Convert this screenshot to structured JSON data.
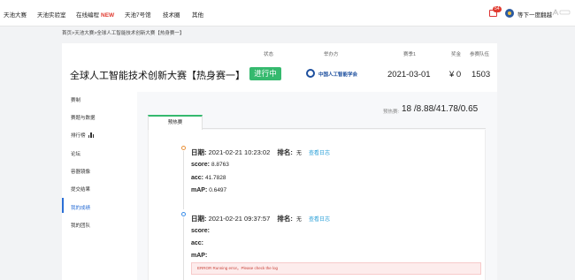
{
  "nav": {
    "items": [
      "天池大赛",
      "天池实验室",
      "在线编程",
      "天池7号馆",
      "技术圈",
      "其他"
    ],
    "new_badge": "NEW",
    "message_count": "54",
    "username": "等下一度翻越"
  },
  "breadcrumb": "首页>天池大赛>全球人工智能技术创新大赛【热身赛一】",
  "competition": {
    "columns": {
      "status": "状态",
      "organizer": "举办方",
      "season": "赛季1",
      "prize": "奖金",
      "teams": "参赛队伍"
    },
    "title": "全球人工智能技术创新大赛【热身赛一】",
    "status": "进行中",
    "organizer": "中国人工智能学会",
    "season_date": "2021-03-01",
    "prize": "¥ 0",
    "teams": "1503"
  },
  "sidebar": {
    "items": [
      "赛制",
      "赛题与数据",
      "排行榜",
      "论坛",
      "容器镜像",
      "提交结果",
      "我的成绩",
      "我的团队"
    ],
    "active_index": 6
  },
  "scores": {
    "label": "预热赛:",
    "value": "18 /8.88/41.78/0.65"
  },
  "tabs": [
    "预热赛"
  ],
  "records": [
    {
      "date_label": "日期:",
      "date": "2021-02-21 10:23:02",
      "rank_label": "排名:",
      "rank": "无",
      "log_link": "查看日志",
      "metrics": [
        {
          "label": "score:",
          "value": "8.8763"
        },
        {
          "label": "acc:",
          "value": "41.7828"
        },
        {
          "label": "mAP:",
          "value": "0.6497"
        }
      ]
    },
    {
      "date_label": "日期:",
      "date": "2021-02-21 09:37:57",
      "rank_label": "排名:",
      "rank": "无",
      "log_link": "查看日志",
      "metrics": [
        {
          "label": "score:",
          "value": ""
        },
        {
          "label": "acc:",
          "value": ""
        },
        {
          "label": "mAP:",
          "value": ""
        }
      ],
      "error": "ERROR Running error。Please check the log"
    }
  ],
  "colors": {
    "accent_green": "#35b96e",
    "link_blue": "#2ba0d8",
    "active_blue": "#2b6fd6",
    "error_red": "#c9463d"
  }
}
